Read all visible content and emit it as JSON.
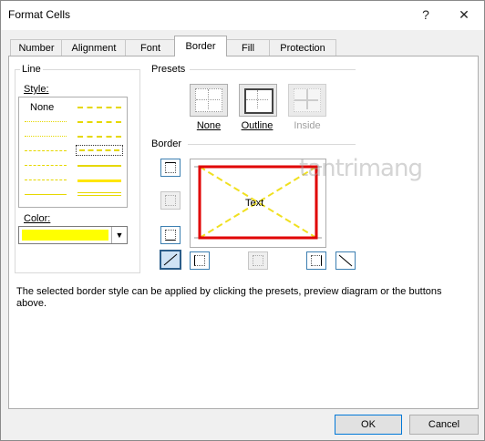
{
  "window": {
    "title": "Format Cells",
    "help_glyph": "?",
    "close_glyph": "✕"
  },
  "tabs": [
    {
      "label": "Number"
    },
    {
      "label": "Alignment"
    },
    {
      "label": "Font"
    },
    {
      "label": "Border",
      "active": true
    },
    {
      "label": "Fill"
    },
    {
      "label": "Protection"
    }
  ],
  "line_group": {
    "label": "Line",
    "style_label": "Style:",
    "none_label": "None",
    "color_label": "Color:",
    "color_value": "#ffff00"
  },
  "presets": {
    "label": "Presets",
    "items": [
      {
        "label": "None",
        "icon": "preset-none-icon"
      },
      {
        "label": "Outline",
        "icon": "preset-outline-icon"
      },
      {
        "label": "Inside",
        "icon": "preset-inside-icon",
        "disabled": true
      }
    ]
  },
  "border": {
    "label": "Border",
    "preview_text": "Text",
    "preview_border_color": "#e00000",
    "diagonal_color": "#f0e020"
  },
  "description": "The selected border style can be applied by clicking the presets, preview diagram or the buttons above.",
  "watermark": "tantrimang",
  "buttons": {
    "ok": "OK",
    "cancel": "Cancel"
  }
}
